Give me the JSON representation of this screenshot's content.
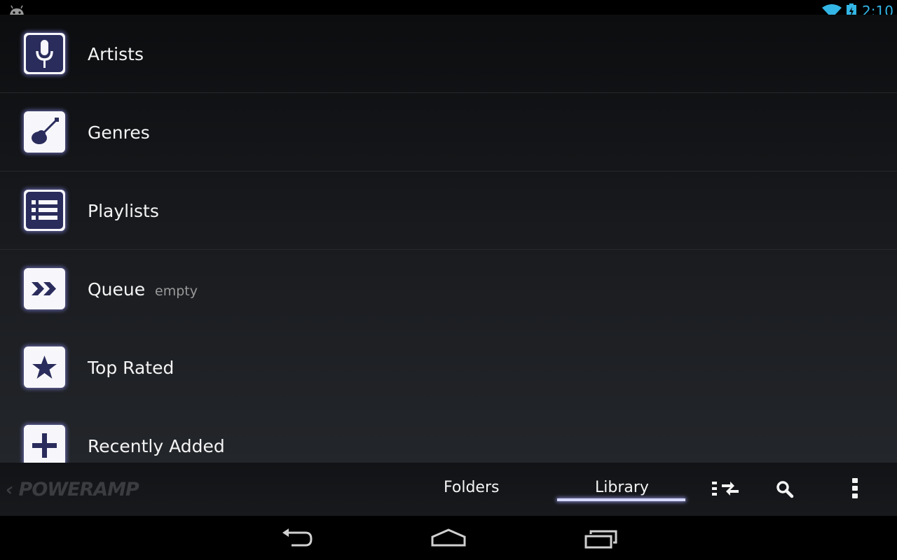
{
  "status_bar": {
    "time": "2:10",
    "accent_color": "#33b5e5",
    "icons": [
      "android-debug-icon",
      "wifi-icon",
      "battery-charging-icon"
    ]
  },
  "library_items": [
    {
      "label": "Artists",
      "icon": "microphone-icon",
      "sub": ""
    },
    {
      "label": "Genres",
      "icon": "guitar-icon",
      "sub": ""
    },
    {
      "label": "Playlists",
      "icon": "list-icon",
      "sub": ""
    },
    {
      "label": "Queue",
      "icon": "double-arrow-icon",
      "sub": "empty"
    },
    {
      "label": "Top Rated",
      "icon": "star-icon",
      "sub": ""
    },
    {
      "label": "Recently Added",
      "icon": "plus-icon",
      "sub": ""
    }
  ],
  "action_bar": {
    "logo_text": "POWERAMP",
    "tabs": [
      {
        "label": "Folders",
        "selected": false
      },
      {
        "label": "Library",
        "selected": true
      }
    ],
    "icons": [
      "sort-icon",
      "search-icon",
      "overflow-menu-icon"
    ]
  },
  "nav_bar": {
    "buttons": [
      "back-icon",
      "home-icon",
      "recent-apps-icon"
    ]
  }
}
